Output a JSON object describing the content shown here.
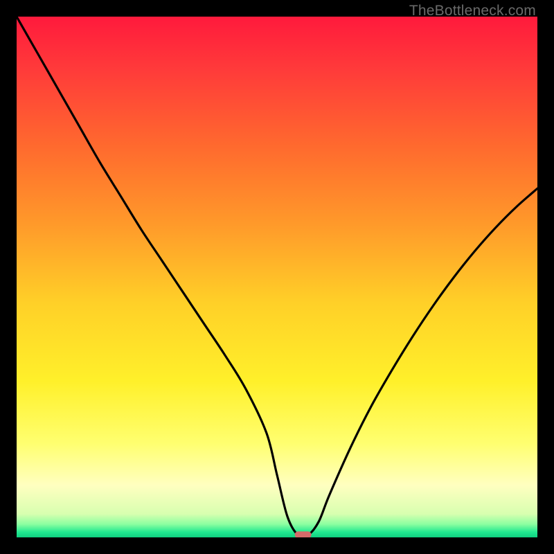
{
  "watermark": "TheBottleneck.com",
  "chart_data": {
    "type": "line",
    "title": "",
    "xlabel": "",
    "ylabel": "",
    "xlim": [
      0,
      100
    ],
    "ylim": [
      0,
      100
    ],
    "background_gradient": {
      "stops": [
        {
          "offset": 0.0,
          "color": "#ff1a3c"
        },
        {
          "offset": 0.1,
          "color": "#ff3a3a"
        },
        {
          "offset": 0.25,
          "color": "#ff6a2e"
        },
        {
          "offset": 0.4,
          "color": "#ff9a2a"
        },
        {
          "offset": 0.55,
          "color": "#ffd028"
        },
        {
          "offset": 0.7,
          "color": "#fff02a"
        },
        {
          "offset": 0.82,
          "color": "#ffff70"
        },
        {
          "offset": 0.9,
          "color": "#ffffc0"
        },
        {
          "offset": 0.955,
          "color": "#d8ffb0"
        },
        {
          "offset": 0.975,
          "color": "#8affa0"
        },
        {
          "offset": 0.99,
          "color": "#20e890"
        },
        {
          "offset": 1.0,
          "color": "#10d080"
        }
      ]
    },
    "series": [
      {
        "name": "bottleneck-curve",
        "color": "#000000",
        "x": [
          0.0,
          4.0,
          8.0,
          12.0,
          16.0,
          20.0,
          24.0,
          28.0,
          32.0,
          36.0,
          40.0,
          44.0,
          48.0,
          50.0,
          52.0,
          54.0,
          56.0,
          58.0,
          60.0,
          64.0,
          68.0,
          72.0,
          76.0,
          80.0,
          84.0,
          88.0,
          92.0,
          96.0,
          100.0
        ],
        "y": [
          100.0,
          93.0,
          86.0,
          79.0,
          72.0,
          65.5,
          59.0,
          53.0,
          47.0,
          41.0,
          35.0,
          28.5,
          20.0,
          12.0,
          4.0,
          0.5,
          0.5,
          3.0,
          8.0,
          17.0,
          25.0,
          32.0,
          38.5,
          44.5,
          50.0,
          55.0,
          59.5,
          63.5,
          67.0
        ]
      }
    ],
    "marker": {
      "name": "optimal-marker",
      "x": 55.0,
      "y": 0.5,
      "color": "#d46a6a",
      "shape": "rounded-rect",
      "width_pct": 3.2,
      "height_pct": 1.3
    }
  }
}
